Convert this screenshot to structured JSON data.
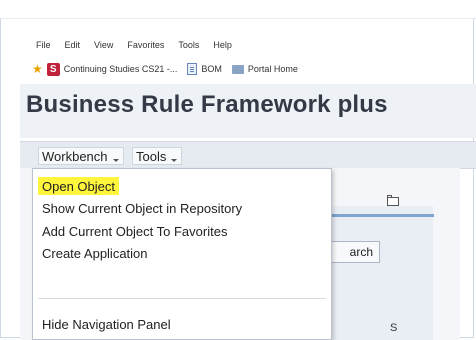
{
  "browser_menu": [
    "File",
    "Edit",
    "View",
    "Favorites",
    "Tools",
    "Help"
  ],
  "favorites": [
    {
      "label": "Continuing Studies CS21 -...",
      "icon": "s-logo-icon"
    },
    {
      "label": "BOM",
      "icon": "document-icon"
    },
    {
      "label": "Portal Home",
      "icon": "portal-icon"
    }
  ],
  "app": {
    "title": "Business Rule Framework plus",
    "menus": [
      "Workbench",
      "Tools"
    ]
  },
  "dropdown": {
    "items": [
      "Open Object",
      "Show Current Object in Repository",
      "Add Current Object To Favorites",
      "Create Application",
      "Hide Navigation Panel"
    ],
    "highlight_color": "#fff53c"
  },
  "background": {
    "search_label": "arch",
    "small_label": "S"
  }
}
